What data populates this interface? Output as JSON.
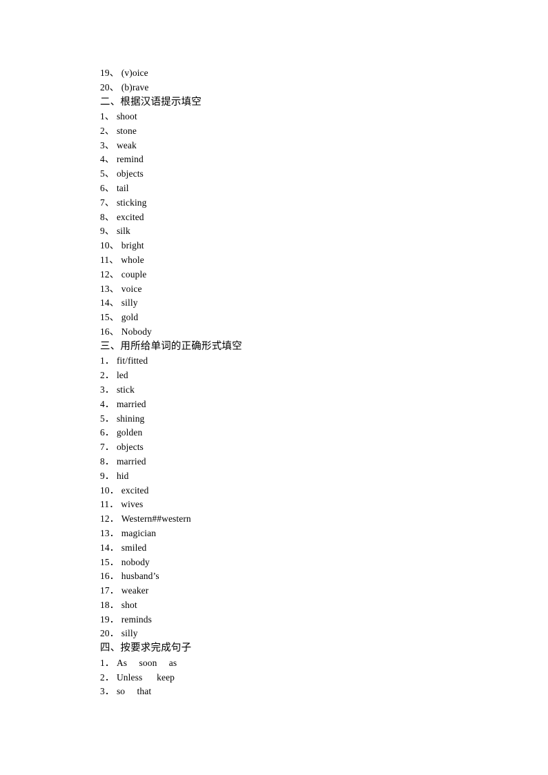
{
  "document": {
    "background_color": "#ffffff",
    "text_color": "#000000",
    "page_size": "794x1123"
  },
  "blocks": [
    {
      "kind": "item",
      "num": "19",
      "sep": "、",
      "text": "(v)oice"
    },
    {
      "kind": "item",
      "num": "20",
      "sep": "、",
      "text": "(b)rave"
    },
    {
      "kind": "heading",
      "text": "二、根据汉语提示填空"
    },
    {
      "kind": "item",
      "num": "1",
      "sep": "、",
      "text": "shoot"
    },
    {
      "kind": "item",
      "num": "2",
      "sep": "、",
      "text": "stone"
    },
    {
      "kind": "item",
      "num": "3",
      "sep": "、",
      "text": "weak"
    },
    {
      "kind": "item",
      "num": "4",
      "sep": "、",
      "text": "remind"
    },
    {
      "kind": "item",
      "num": "5",
      "sep": "、",
      "text": "objects"
    },
    {
      "kind": "item",
      "num": "6",
      "sep": "、",
      "text": "tail"
    },
    {
      "kind": "item",
      "num": "7",
      "sep": "、",
      "text": "sticking"
    },
    {
      "kind": "item",
      "num": "8",
      "sep": "、",
      "text": "excited"
    },
    {
      "kind": "item",
      "num": "9",
      "sep": "、",
      "text": "silk"
    },
    {
      "kind": "item",
      "num": "10",
      "sep": "、",
      "text": "bright"
    },
    {
      "kind": "item",
      "num": "11",
      "sep": "、",
      "text": "whole"
    },
    {
      "kind": "item",
      "num": "12",
      "sep": "、",
      "text": "couple"
    },
    {
      "kind": "item",
      "num": "13",
      "sep": "、",
      "text": "voice"
    },
    {
      "kind": "item",
      "num": "14",
      "sep": "、",
      "text": "silly"
    },
    {
      "kind": "item",
      "num": "15",
      "sep": "、",
      "text": "gold"
    },
    {
      "kind": "item",
      "num": "16",
      "sep": "、",
      "text": "Nobody"
    },
    {
      "kind": "heading",
      "text": "三、用所给单词的正确形式填空"
    },
    {
      "kind": "item",
      "num": "1",
      "sep": "．",
      "text": "fit/fitted"
    },
    {
      "kind": "item",
      "num": "2",
      "sep": "．",
      "text": "led"
    },
    {
      "kind": "item",
      "num": "3",
      "sep": "．",
      "text": "stick"
    },
    {
      "kind": "item",
      "num": "4",
      "sep": "．",
      "text": "married"
    },
    {
      "kind": "item",
      "num": "5",
      "sep": "．",
      "text": "shining"
    },
    {
      "kind": "item",
      "num": "6",
      "sep": "．",
      "text": "golden"
    },
    {
      "kind": "item",
      "num": "7",
      "sep": "．",
      "text": "objects"
    },
    {
      "kind": "item",
      "num": "8",
      "sep": "．",
      "text": "married"
    },
    {
      "kind": "item",
      "num": "9",
      "sep": "．",
      "text": "hid"
    },
    {
      "kind": "item",
      "num": "10",
      "sep": "．",
      "text": "excited"
    },
    {
      "kind": "item",
      "num": "11",
      "sep": "．",
      "text": "wives"
    },
    {
      "kind": "item",
      "num": "12",
      "sep": "．",
      "text": "Western##western"
    },
    {
      "kind": "item",
      "num": "13",
      "sep": "．",
      "text": "magician"
    },
    {
      "kind": "item",
      "num": "14",
      "sep": "．",
      "text": "smiled"
    },
    {
      "kind": "item",
      "num": "15",
      "sep": "．",
      "text": "nobody"
    },
    {
      "kind": "item",
      "num": "16",
      "sep": "．",
      "text": "husband’s"
    },
    {
      "kind": "item",
      "num": "17",
      "sep": "．",
      "text": "weaker"
    },
    {
      "kind": "item",
      "num": "18",
      "sep": "．",
      "text": "shot"
    },
    {
      "kind": "item",
      "num": "19",
      "sep": "．",
      "text": "reminds"
    },
    {
      "kind": "item",
      "num": "20",
      "sep": "．",
      "text": "silly"
    },
    {
      "kind": "heading",
      "text": "四、按要求完成句子"
    },
    {
      "kind": "item",
      "num": "1",
      "sep": "．",
      "text": "As     soon     as"
    },
    {
      "kind": "item",
      "num": "2",
      "sep": "．",
      "text": "Unless      keep"
    },
    {
      "kind": "item",
      "num": "3",
      "sep": "．",
      "text": "so     that"
    }
  ]
}
